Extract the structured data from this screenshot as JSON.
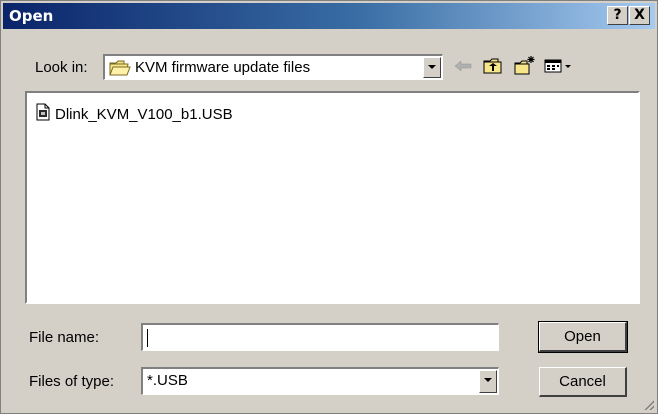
{
  "window": {
    "title": "Open",
    "help_button": "?",
    "close_button": "X"
  },
  "look_in": {
    "label": "Look in:",
    "value": "KVM firmware update files"
  },
  "toolbar": {
    "icons": [
      "back-arrow-icon",
      "up-folder-icon",
      "new-folder-icon",
      "view-menu-icon"
    ]
  },
  "files": [
    {
      "name": "Dlink_KVM_V100_b1.USB",
      "icon": "file-icon"
    }
  ],
  "file_name": {
    "label": "File name:",
    "value": ""
  },
  "file_type": {
    "label": "Files of type:",
    "value": "*.USB"
  },
  "buttons": {
    "open": "Open",
    "cancel": "Cancel"
  }
}
